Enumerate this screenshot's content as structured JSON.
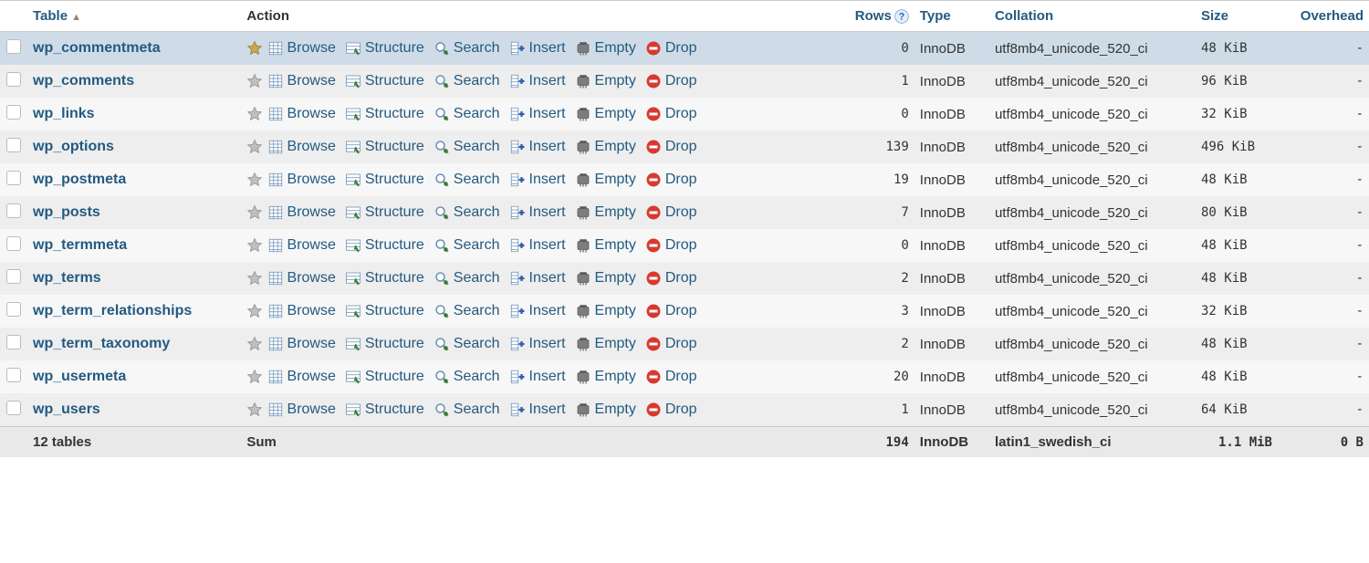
{
  "headers": {
    "table": "Table",
    "action": "Action",
    "rows": "Rows",
    "type": "Type",
    "collation": "Collation",
    "size": "Size",
    "overhead": "Overhead"
  },
  "actions": {
    "browse": "Browse",
    "structure": "Structure",
    "search": "Search",
    "insert": "Insert",
    "empty": "Empty",
    "drop": "Drop"
  },
  "rows": [
    {
      "name": "wp_commentmeta",
      "rows": "0",
      "type": "InnoDB",
      "collation": "utf8mb4_unicode_520_ci",
      "size": "48 KiB",
      "overhead": "-",
      "fav": true,
      "hover": true
    },
    {
      "name": "wp_comments",
      "rows": "1",
      "type": "InnoDB",
      "collation": "utf8mb4_unicode_520_ci",
      "size": "96 KiB",
      "overhead": "-",
      "fav": false
    },
    {
      "name": "wp_links",
      "rows": "0",
      "type": "InnoDB",
      "collation": "utf8mb4_unicode_520_ci",
      "size": "32 KiB",
      "overhead": "-",
      "fav": false
    },
    {
      "name": "wp_options",
      "rows": "139",
      "type": "InnoDB",
      "collation": "utf8mb4_unicode_520_ci",
      "size": "496 KiB",
      "overhead": "-",
      "fav": false
    },
    {
      "name": "wp_postmeta",
      "rows": "19",
      "type": "InnoDB",
      "collation": "utf8mb4_unicode_520_ci",
      "size": "48 KiB",
      "overhead": "-",
      "fav": false
    },
    {
      "name": "wp_posts",
      "rows": "7",
      "type": "InnoDB",
      "collation": "utf8mb4_unicode_520_ci",
      "size": "80 KiB",
      "overhead": "-",
      "fav": false
    },
    {
      "name": "wp_termmeta",
      "rows": "0",
      "type": "InnoDB",
      "collation": "utf8mb4_unicode_520_ci",
      "size": "48 KiB",
      "overhead": "-",
      "fav": false
    },
    {
      "name": "wp_terms",
      "rows": "2",
      "type": "InnoDB",
      "collation": "utf8mb4_unicode_520_ci",
      "size": "48 KiB",
      "overhead": "-",
      "fav": false
    },
    {
      "name": "wp_term_relationships",
      "rows": "3",
      "type": "InnoDB",
      "collation": "utf8mb4_unicode_520_ci",
      "size": "32 KiB",
      "overhead": "-",
      "fav": false
    },
    {
      "name": "wp_term_taxonomy",
      "rows": "2",
      "type": "InnoDB",
      "collation": "utf8mb4_unicode_520_ci",
      "size": "48 KiB",
      "overhead": "-",
      "fav": false
    },
    {
      "name": "wp_usermeta",
      "rows": "20",
      "type": "InnoDB",
      "collation": "utf8mb4_unicode_520_ci",
      "size": "48 KiB",
      "overhead": "-",
      "fav": false
    },
    {
      "name": "wp_users",
      "rows": "1",
      "type": "InnoDB",
      "collation": "utf8mb4_unicode_520_ci",
      "size": "64 KiB",
      "overhead": "-",
      "fav": false
    }
  ],
  "summary": {
    "count_label": "12 tables",
    "sum_label": "Sum",
    "rows": "194",
    "type": "InnoDB",
    "collation": "latin1_swedish_ci",
    "size": "1.1 MiB",
    "overhead": "0 B"
  }
}
